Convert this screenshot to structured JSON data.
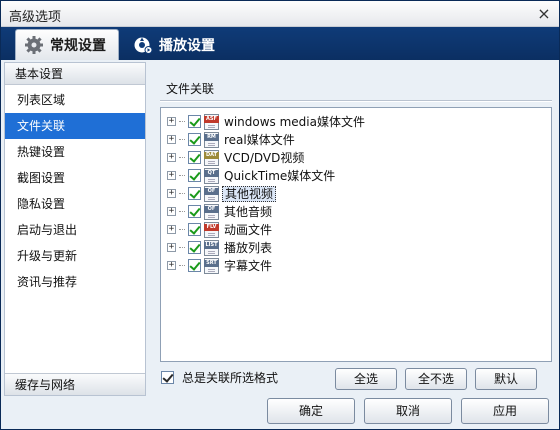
{
  "window": {
    "title": "高级选项",
    "close_glyph": "×"
  },
  "tabs": [
    {
      "label": "常规设置",
      "icon": "gear-icon",
      "active": true
    },
    {
      "label": "播放设置",
      "icon": "play-settings-icon",
      "active": false
    }
  ],
  "sidebar": {
    "header": "基本设置",
    "items": [
      {
        "label": "列表区域"
      },
      {
        "label": "文件关联"
      },
      {
        "label": "热键设置"
      },
      {
        "label": "截图设置"
      },
      {
        "label": "隐私设置"
      },
      {
        "label": "启动与退出"
      },
      {
        "label": "升级与更新"
      },
      {
        "label": "资讯与推荐"
      }
    ],
    "selected_index": 1,
    "footer": "缓存与网络"
  },
  "panel": {
    "group_label": "文件关联",
    "tree": [
      {
        "tag": "ASF",
        "color": "#c0392b",
        "label": "windows media媒体文件"
      },
      {
        "tag": "RM",
        "color": "#5a6f8c",
        "label": "real媒体文件"
      },
      {
        "tag": "DAT",
        "color": "#9c8a3a",
        "label": "VCD/DVD视频"
      },
      {
        "tag": "QT",
        "color": "#5a6f8c",
        "label": "QuickTime媒体文件"
      },
      {
        "tag": "OF",
        "color": "#5a6f8c",
        "label": "其他视频",
        "focused": true
      },
      {
        "tag": "OF",
        "color": "#5a6f8c",
        "label": "其他音频"
      },
      {
        "tag": "FLV",
        "color": "#c0392b",
        "label": "动画文件"
      },
      {
        "tag": "LIST",
        "color": "#5a6f8c",
        "label": "播放列表"
      },
      {
        "tag": "SRT",
        "color": "#5a6f8c",
        "label": "字幕文件"
      }
    ],
    "always_associate_label": "总是关联所选格式",
    "buttons": {
      "select_all": "全选",
      "select_none": "全不选",
      "default": "默认"
    }
  },
  "footer_buttons": {
    "ok": "确定",
    "cancel": "取消",
    "apply": "应用"
  }
}
